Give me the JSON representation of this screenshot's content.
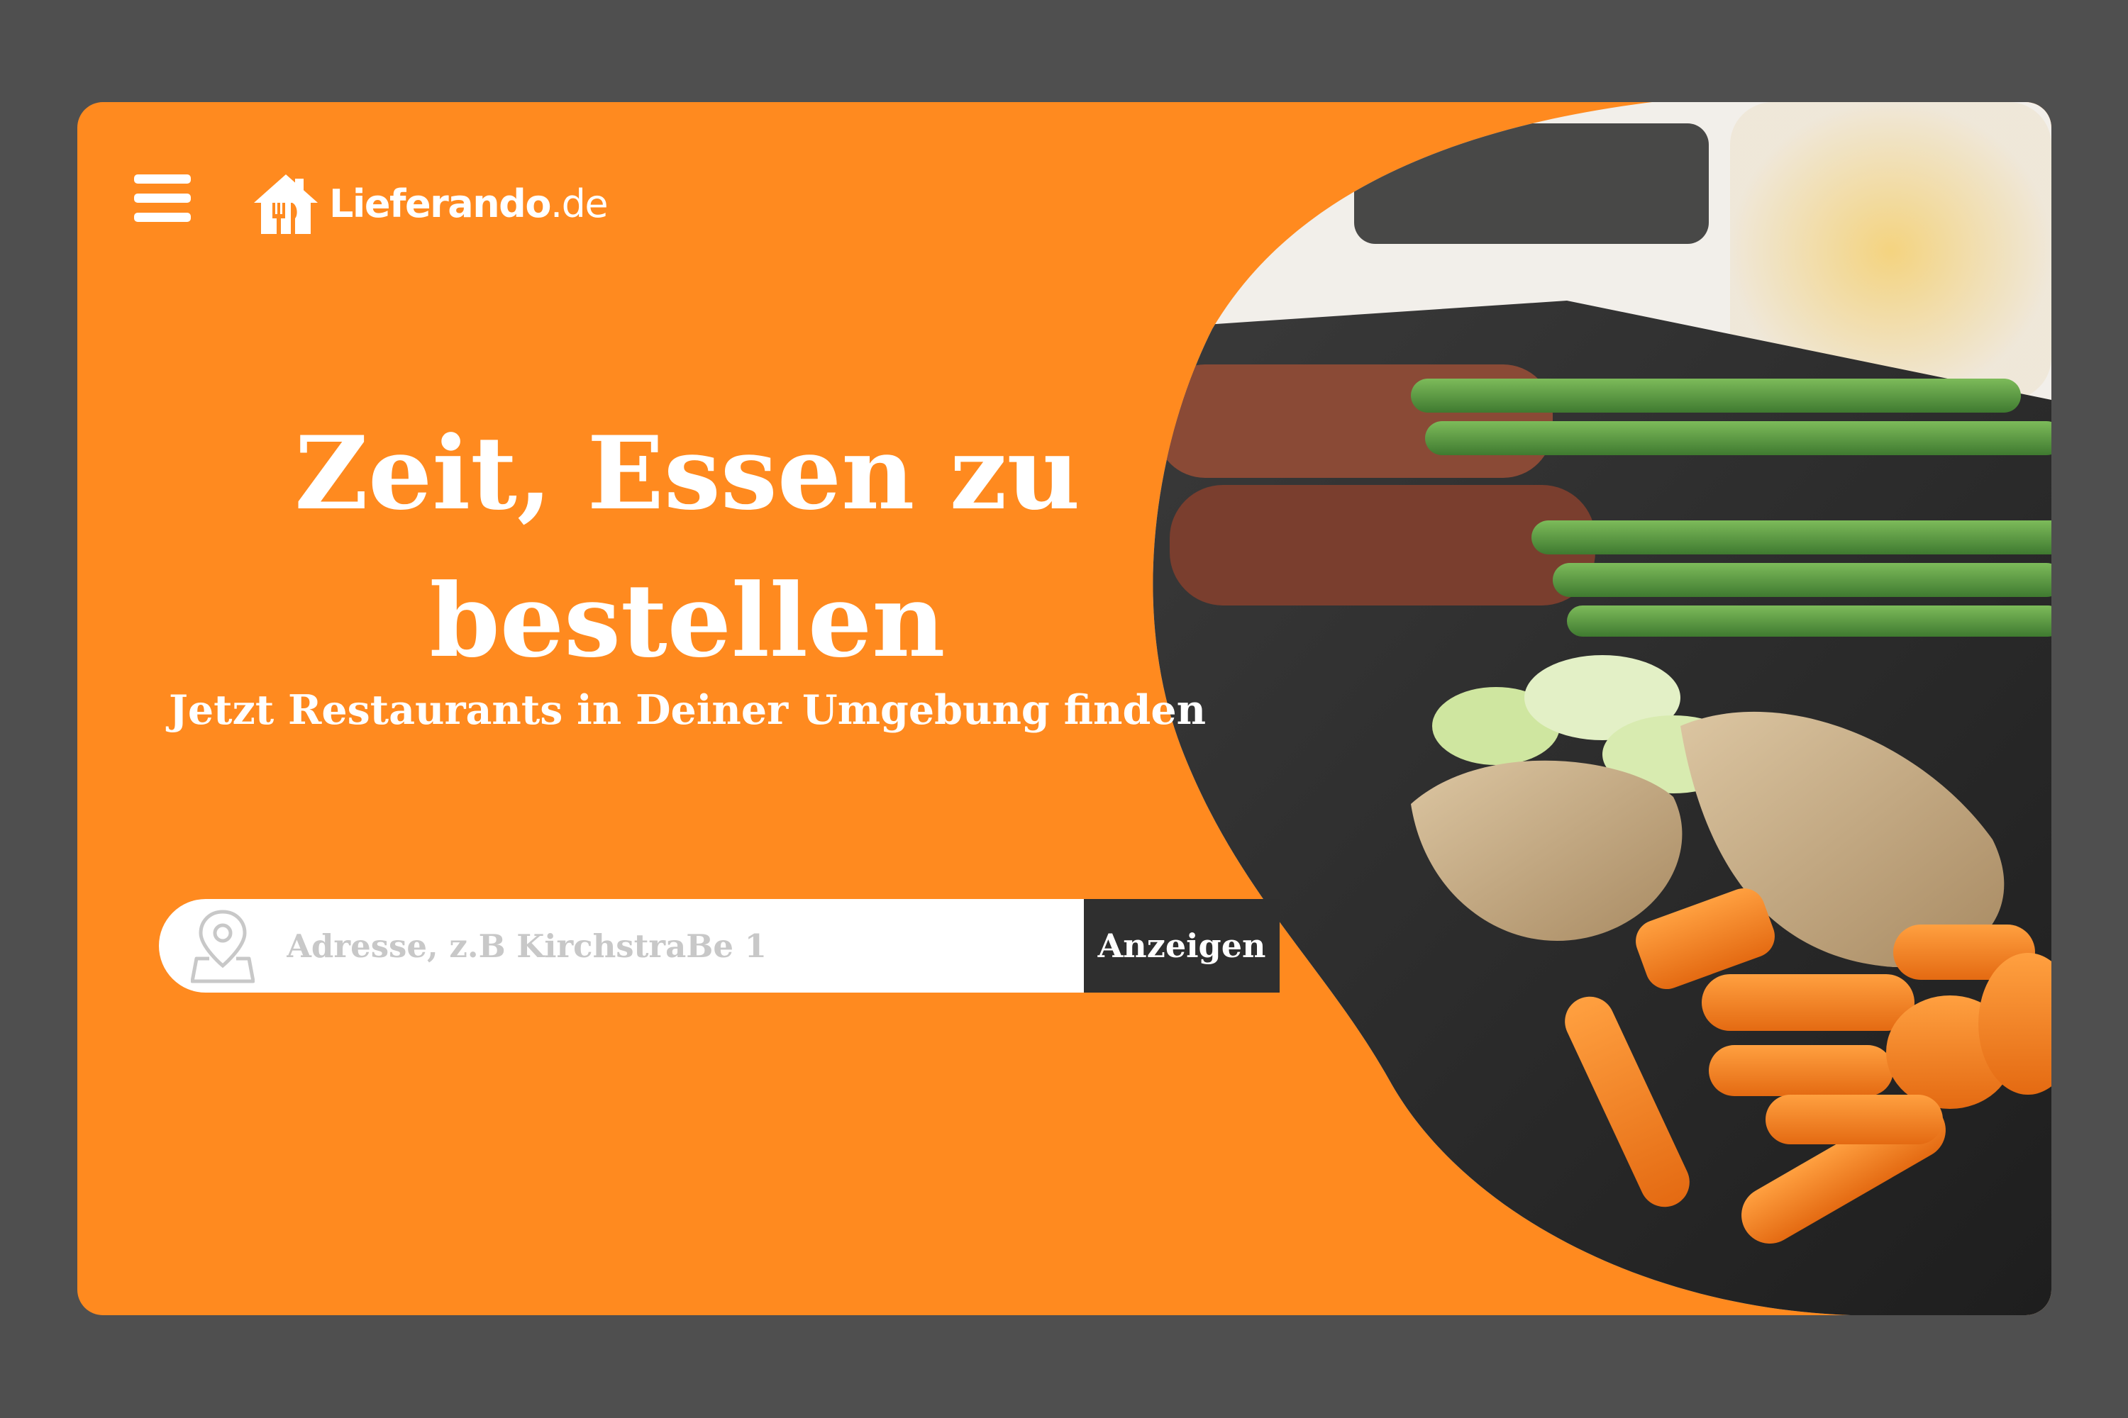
{
  "header": {
    "menu_icon": "hamburger-menu-icon",
    "logo_icon": "house-fork-knife-icon",
    "logo_name": "Lieferando",
    "logo_tld": ".de"
  },
  "hero": {
    "headline": "Zeit, Essen zu bestellen",
    "subline": "Jetzt Restaurants in Deiner Umgebung finden",
    "image": "food-photo-grilled-chicken-asparagus-carrots"
  },
  "search": {
    "icon": "location-pin-map-icon",
    "placeholder": "Adresse, z.B KirchstraBe 1",
    "value": "",
    "button_label": "Anzeigen"
  },
  "colors": {
    "brand_orange": "#ff8a1f",
    "page_background": "#4f4f4f",
    "button_dark": "#2f2f2f",
    "placeholder_gray": "#c8c8c8"
  }
}
